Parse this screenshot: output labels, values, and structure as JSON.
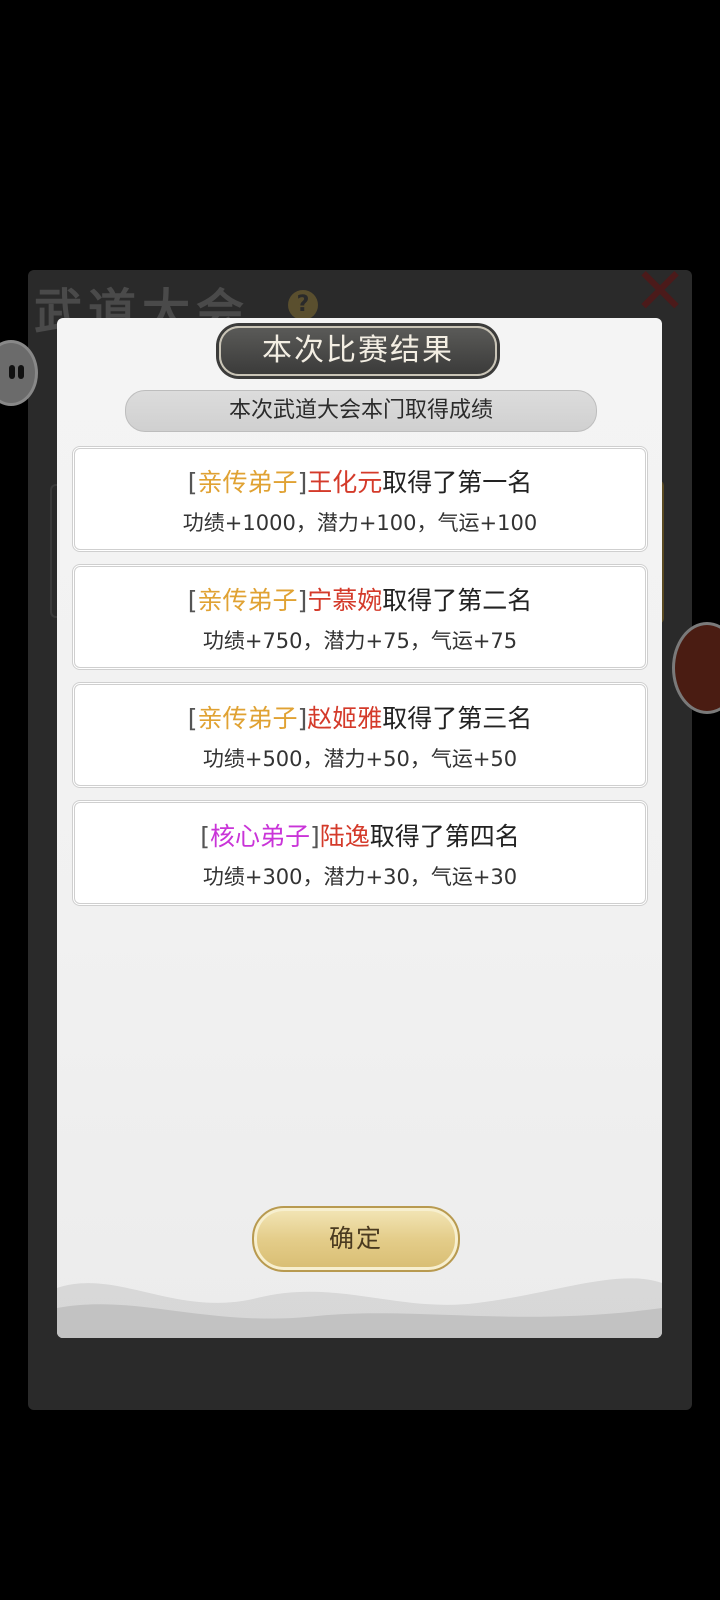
{
  "background": {
    "panel_title": "武道大会",
    "help_glyph": "?",
    "close_glyph": "✕"
  },
  "modal": {
    "title": "本次比赛结果",
    "subtitle": "本次武道大会本门取得成绩",
    "results": [
      {
        "rank": "亲传弟子",
        "rank_color": "#e0a233",
        "name": "王化元",
        "achievement": "取得了第一名",
        "rewards": "功绩+1000，潜力+100，气运+100"
      },
      {
        "rank": "亲传弟子",
        "rank_color": "#e0a233",
        "name": "宁慕婉",
        "achievement": "取得了第二名",
        "rewards": "功绩+750，潜力+75，气运+75"
      },
      {
        "rank": "亲传弟子",
        "rank_color": "#e0a233",
        "name": "赵姬雅",
        "achievement": "取得了第三名",
        "rewards": "功绩+500，潜力+50，气运+50"
      },
      {
        "rank": "核心弟子",
        "rank_color": "#c934d8",
        "name": "陆逸",
        "achievement": "取得了第四名",
        "rewards": "功绩+300，潜力+30，气运+30"
      }
    ],
    "confirm_label": "确定"
  },
  "colors": {
    "name_red": "#d43a2a",
    "confirm_gold": "#e4cd8a",
    "title_dark": "#3b3b3a"
  }
}
